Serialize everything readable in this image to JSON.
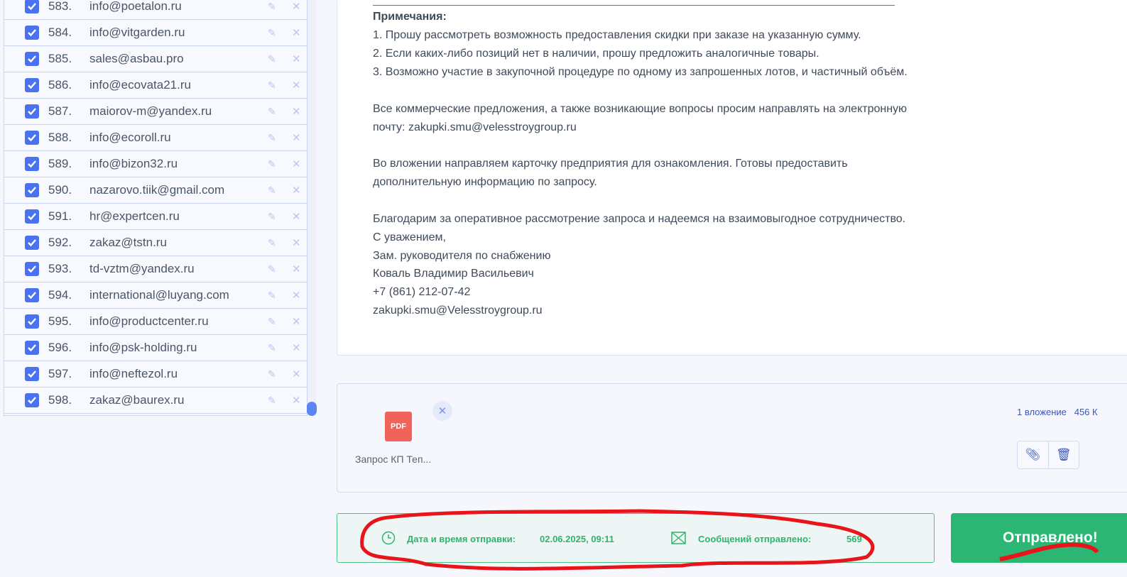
{
  "recipients": [
    {
      "n": "583.",
      "email": "info@poetalon.ru"
    },
    {
      "n": "584.",
      "email": "info@vitgarden.ru"
    },
    {
      "n": "585.",
      "email": "sales@asbau.pro"
    },
    {
      "n": "586.",
      "email": "info@ecovata21.ru"
    },
    {
      "n": "587.",
      "email": "maiorov-m@yandex.ru"
    },
    {
      "n": "588.",
      "email": "info@ecoroll.ru"
    },
    {
      "n": "589.",
      "email": "info@bizon32.ru"
    },
    {
      "n": "590.",
      "email": "nazarovo.tiik@gmail.com"
    },
    {
      "n": "591.",
      "email": "hr@expertcen.ru"
    },
    {
      "n": "592.",
      "email": "zakaz@tstn.ru"
    },
    {
      "n": "593.",
      "email": "td-vztm@yandex.ru"
    },
    {
      "n": "594.",
      "email": "international@luyang.com"
    },
    {
      "n": "595.",
      "email": "info@productcenter.ru"
    },
    {
      "n": "596.",
      "email": "info@psk-holding.ru"
    },
    {
      "n": "597.",
      "email": "info@neftezol.ru"
    },
    {
      "n": "598.",
      "email": "zakaz@baurex.ru"
    }
  ],
  "message": {
    "lines": [
      {
        "t": "Примечания:",
        "bold": true
      },
      {
        "t": "1. Прошу рассмотреть возможность предоставления скидки при заказе на указанную сумму."
      },
      {
        "t": "2. Если каких-либо позиций нет в наличии, прошу предложить аналогичные товары."
      },
      {
        "t": "3. Возможно участие в закупочной процедуре по одному из запрошенных лотов, и частичный объём."
      },
      {
        "t": "Все коммерческие предложения, а также возникающие вопросы просим направлять на электронную"
      },
      {
        "t": "почту: zakupki.smu@velesstroygroup.ru"
      },
      {
        "t": "Во вложении направляем карточку предприятия для ознакомления. Готовы предоставить"
      },
      {
        "t": "дополнительную информацию по запросу."
      },
      {
        "t": "Благодарим за оперативное рассмотрение запроса и надеемся на взаимовыгодное сотрудничество."
      },
      {
        "t": "С уважением,"
      },
      {
        "t": "Зам. руководителя по снабжению"
      },
      {
        "t": "Коваль Владимир Васильевич"
      },
      {
        "t": "+7 (861) 212-07-42"
      },
      {
        "t": "zakupki.smu@Velesstroygroup.ru"
      }
    ]
  },
  "attachment": {
    "type": "PDF",
    "name": "Запрос КП Теп...",
    "count": "1 вложение",
    "size": "456 К"
  },
  "status": {
    "date_label": "Дата и время отправки:",
    "date": "02.06.2025, 09:11",
    "sent_label": "Сообщений отправлено:",
    "sent": "569"
  },
  "send_button": "Отправлено!"
}
